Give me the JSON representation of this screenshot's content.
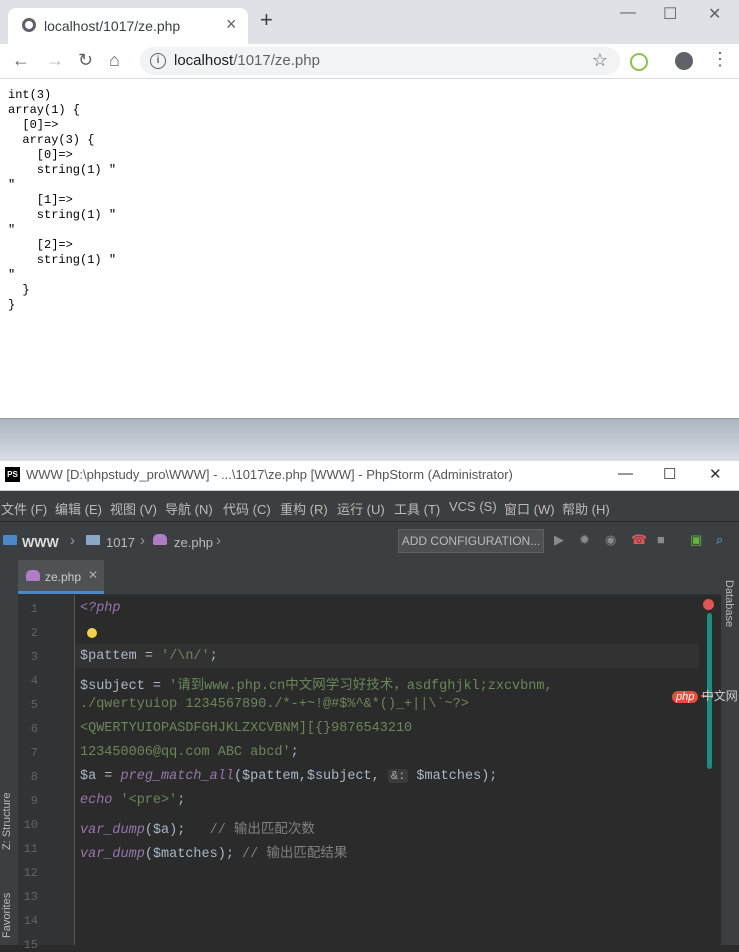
{
  "browser": {
    "tab_title": "localhost/1017/ze.php",
    "url_host": "localhost",
    "url_path": "/1017/ze.php",
    "page_output": "int(3)\narray(1) {\n  [0]=>\n  array(3) {\n    [0]=>\n    string(1) \"\n\"\n    [1]=>\n    string(1) \"\n\"\n    [2]=>\n    string(1) \"\n\"\n  }\n}"
  },
  "ide": {
    "title": "WWW [D:\\phpstudy_pro\\WWW] - ...\\1017\\ze.php [WWW] - PhpStorm (Administrator)",
    "logo": "PS",
    "menu": [
      "文件 (F)",
      "编辑 (E)",
      "视图 (V)",
      "导航 (N)",
      "代码 (C)",
      "重构 (R)",
      "运行 (U)",
      "工具 (T)",
      "VCS (S)",
      "窗口 (W)",
      "帮助 (H)"
    ],
    "breadcrumb": [
      "WWW",
      "1017",
      "ze.php"
    ],
    "add_configuration": "ADD CONFIGURATION...",
    "editor_tab": "ze.php",
    "left_tools": [
      "Z: Structure",
      "Favorites"
    ],
    "right_tools": [
      "Database"
    ],
    "line_numbers": [
      "1",
      "2",
      "3",
      "4",
      "5",
      "6",
      "7",
      "8",
      "9",
      "10",
      "11",
      "12",
      "13",
      "14",
      "15"
    ],
    "code": {
      "l1": "<?php",
      "l3_var": "$pattem",
      "l3_eq": " = ",
      "l3_str": "'/\\n/'",
      "l3_end": ";",
      "l4_var": "$subject",
      "l4_eq": " = ",
      "l4_str": "'请到www.php.cn中文网学习好技术，asdfghjkl;zxcvbnm,",
      "l5_str": "./qwertyuiop 1234567890./*-+~!@#$%^&*()_+||\\`~?>",
      "l6_str": "<QWERTYUIOPASDFGHJKLZXCVBNM][{}9876543210",
      "l7_str": "123450006@qq.com ABC abcd'",
      "l7_end": ";",
      "l8_var": "$a",
      "l8_eq": " = ",
      "l8_fn": "preg_match_all",
      "l8_args": "($pattem,$subject, ",
      "l8_amp": "&:",
      "l8_rest": " $matches);",
      "l9_kw": "echo",
      "l9_str": " '<pre>'",
      "l9_end": ";",
      "l10_fn": "var_dump",
      "l10_args": "($a);",
      "l10_cm": "   // 输出匹配次数",
      "l11_fn": "var_dump",
      "l11_args": "($matches);",
      "l11_cm": " // 输出匹配结果"
    }
  },
  "watermark": {
    "badge": "php",
    "text": "中文网"
  }
}
